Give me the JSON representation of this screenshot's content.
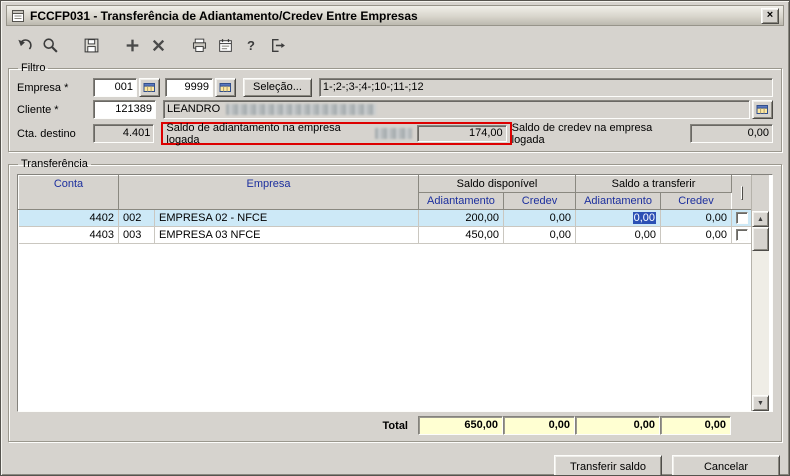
{
  "window": {
    "title": "FCCFP031 - Transferência de Adiantamento/Credev Entre Empresas"
  },
  "icons": {
    "close": "×",
    "help": "?",
    "scroll_up": "▲",
    "scroll_down": "▼"
  },
  "toolbar": {
    "buttons": [
      "undo",
      "search",
      "save",
      "add",
      "delete",
      "print",
      "schedule",
      "help",
      "exit"
    ]
  },
  "filtro": {
    "title": "Filtro",
    "empresa_label": "Empresa *",
    "empresa_code": "001",
    "empresa_code2": "9999",
    "selecao_button": "Seleção...",
    "empresa_selection": "1-;2-;3-;4-;10-;11-;12",
    "cliente_label": "Cliente *",
    "cliente_code": "121389",
    "cliente_name": "LEANDRO",
    "cta_label": "Cta. destino",
    "cta_value": "4.401",
    "saldo_adiantamento_label": "Saldo de adiantamento na empresa logada",
    "saldo_adiantamento_value": "174,00",
    "saldo_credev_label": "Saldo de credev na empresa logada",
    "saldo_credev_value": "0,00"
  },
  "transferencia": {
    "title": "Transferência",
    "headers": {
      "conta": "Conta",
      "empresa": "Empresa",
      "saldo_disponivel": "Saldo disponível",
      "saldo_transferir": "Saldo a transferir",
      "adiantamento": "Adiantamento",
      "credev": "Credev"
    },
    "rows": [
      {
        "conta": "4402",
        "empresa_code": "002",
        "empresa_nome": "EMPRESA 02 - NFCE",
        "disp_adiantamento": "200,00",
        "disp_credev": "0,00",
        "transf_adiantamento": "0,00",
        "transf_credev": "0,00"
      },
      {
        "conta": "4403",
        "empresa_code": "003",
        "empresa_nome": "EMPRESA 03 NFCE",
        "disp_adiantamento": "450,00",
        "disp_credev": "0,00",
        "transf_adiantamento": "0,00",
        "transf_credev": "0,00"
      }
    ],
    "total_label": "Total",
    "totals": {
      "disp_adiantamento": "650,00",
      "disp_credev": "0,00",
      "transf_adiantamento": "0,00",
      "transf_credev": "0,00"
    }
  },
  "footer": {
    "transferir_button": "Transferir saldo",
    "cancelar_button": "Cancelar"
  }
}
